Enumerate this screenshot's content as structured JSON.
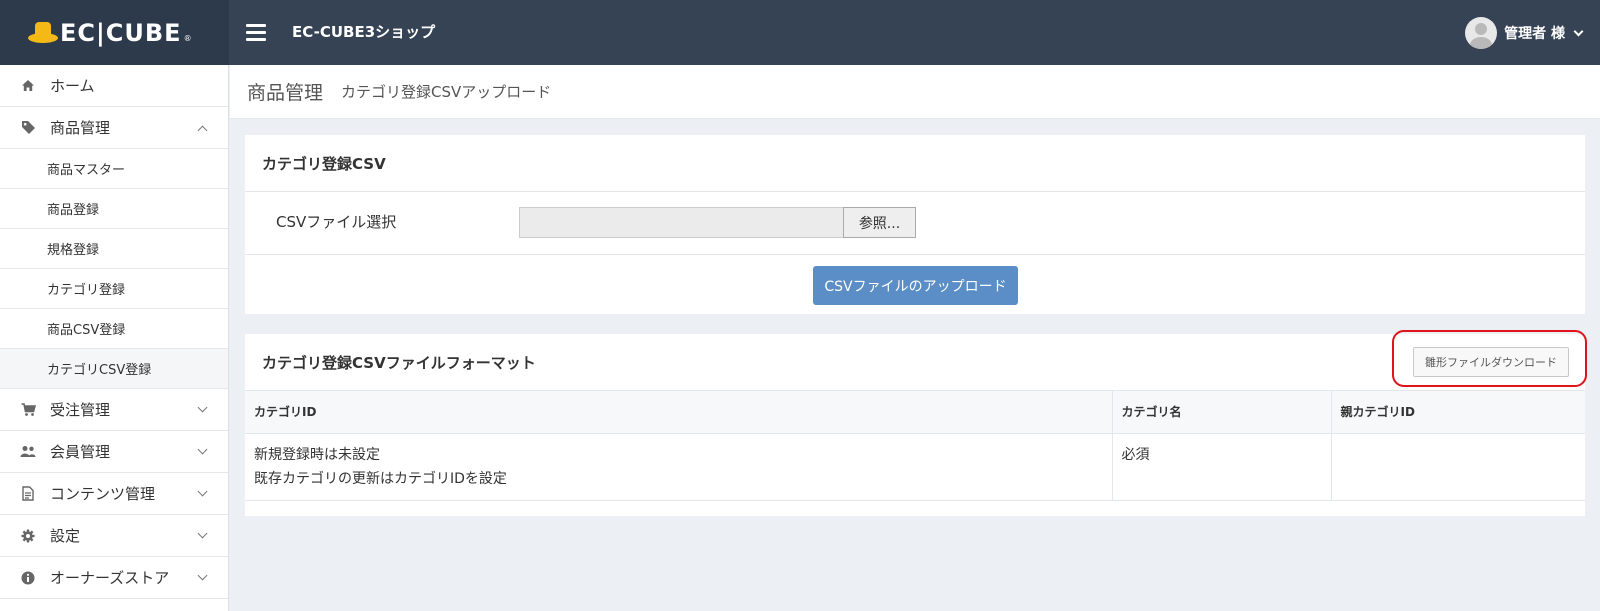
{
  "header": {
    "logo_text": "EC|CUBE",
    "logo_mark": "®",
    "shop_name": "EC-CUBE3ショップ",
    "user_name": "管理者 様"
  },
  "sidebar": {
    "items": [
      {
        "label": "ホーム",
        "icon": "home-icon"
      },
      {
        "label": "商品管理",
        "icon": "tag-icon",
        "expanded": true
      },
      {
        "label": "受注管理",
        "icon": "cart-icon"
      },
      {
        "label": "会員管理",
        "icon": "users-icon"
      },
      {
        "label": "コンテンツ管理",
        "icon": "document-icon"
      },
      {
        "label": "設定",
        "icon": "gear-icon"
      },
      {
        "label": "オーナーズストア",
        "icon": "info-icon"
      }
    ],
    "sub_items": [
      {
        "label": "商品マスター"
      },
      {
        "label": "商品登録"
      },
      {
        "label": "規格登録"
      },
      {
        "label": "カテゴリ登録"
      },
      {
        "label": "商品CSV登録"
      },
      {
        "label": "カテゴリCSV登録",
        "active": true
      }
    ]
  },
  "breadcrumb": {
    "main": "商品管理",
    "sub": "カテゴリ登録CSVアップロード"
  },
  "upload_card": {
    "title": "カテゴリ登録CSV",
    "file_label": "CSVファイル選択",
    "browse_label": "参照...",
    "upload_label": "CSVファイルのアップロード"
  },
  "format_card": {
    "title": "カテゴリ登録CSVファイルフォーマット",
    "download_label": "雛形ファイルダウンロード",
    "columns": [
      "カテゴリID",
      "カテゴリ名",
      "親カテゴリID"
    ],
    "row": {
      "col1_line1": "新規登録時は未設定",
      "col1_line2": "既存カテゴリの更新はカテゴリIDを設定",
      "col2": "必須",
      "col3": ""
    }
  },
  "colors": {
    "header_bg": "#354355",
    "logo_bg": "#2c3a4b",
    "primary_button": "#5b8ec6",
    "highlight": "#e0131b",
    "logo_yellow": "#f5b916"
  }
}
